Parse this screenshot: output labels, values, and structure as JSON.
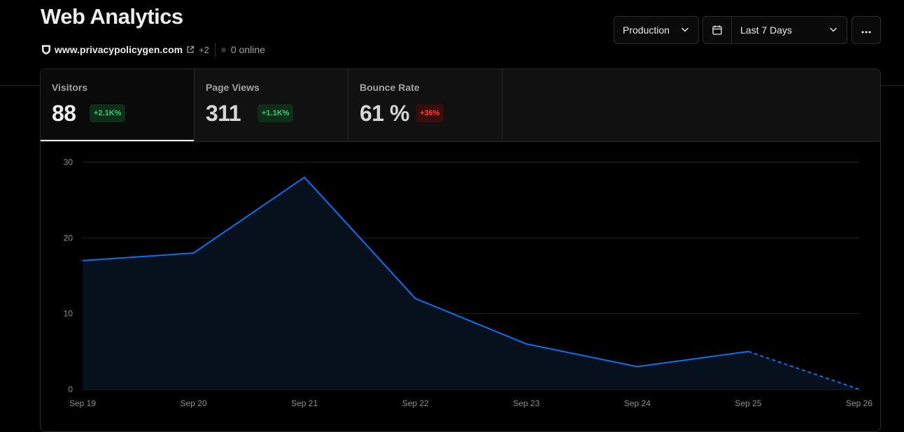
{
  "header": {
    "title": "Web Analytics",
    "domain": "www.privacypolicygen.com",
    "more_domains": "+2",
    "online": "0 online"
  },
  "controls": {
    "environment": "Production",
    "range": "Last 7 Days"
  },
  "metrics": [
    {
      "label": "Visitors",
      "value": "88",
      "change": "+2.1K%",
      "trend": "up"
    },
    {
      "label": "Page Views",
      "value": "311",
      "change": "+1.1K%",
      "trend": "up"
    },
    {
      "label": "Bounce Rate",
      "value": "61 %",
      "change": "+36%",
      "trend": "down"
    }
  ],
  "colors": {
    "accent": "#0a72ef",
    "area_fill": "#07101d",
    "positive": "#2fcc71",
    "negative": "#ff3b3b"
  },
  "chart_data": {
    "type": "area",
    "categories": [
      "Sep 19",
      "Sep 20",
      "Sep 21",
      "Sep 22",
      "Sep 23",
      "Sep 24",
      "Sep 25",
      "Sep 26"
    ],
    "series": [
      {
        "values": [
          17,
          18,
          28,
          12,
          6,
          3,
          5,
          0
        ]
      }
    ],
    "projected_segment": {
      "from": "Sep 25",
      "to": "Sep 26",
      "style": "dashed"
    },
    "yticks": [
      "0",
      "10",
      "20",
      "30"
    ],
    "ylim": [
      0,
      30
    ],
    "grid": true
  }
}
